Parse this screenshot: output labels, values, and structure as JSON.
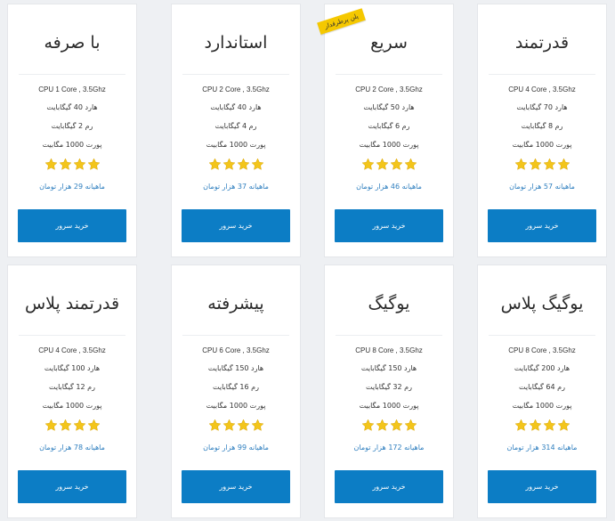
{
  "colors": {
    "accent": "#0c7dc5",
    "price": "#2f7fbf",
    "ribbon": "#f5c800",
    "star": "#f3c51b"
  },
  "icons": {
    "rating": "star-icon"
  },
  "plans": [
    {
      "name": "قدرتمند",
      "cpu": "CPU 4 Core , 3.5Ghz",
      "disk": "هارد 70 گیگابایت",
      "ram": "رم 8 گیگابایت",
      "port": "پورت 1000 مگابیت",
      "rating": 4,
      "price": "ماهیانه 57 هزار تومان",
      "button": "خرید سرور"
    },
    {
      "name": "سریع",
      "cpu": "CPU 2 Core , 3.5Ghz",
      "disk": "هارد 50 گیگابایت",
      "ram": "رم 6 گیگابایت",
      "port": "پورت 1000 مگابیت",
      "rating": 4,
      "price": "ماهیانه 46 هزار تومان",
      "button": "خرید سرور",
      "badge": "پلن پرطرفدار"
    },
    {
      "name": "استاندارد",
      "cpu": "CPU 2 Core , 3.5Ghz",
      "disk": "هارد 40 گیگابایت",
      "ram": "رم 4 گیگابایت",
      "port": "پورت 1000 مگابیت",
      "rating": 4,
      "price": "ماهیانه 37 هزار تومان",
      "button": "خرید سرور"
    },
    {
      "name": "با صرفه",
      "cpu": "CPU 1 Core , 3.5Ghz",
      "disk": "هارد 40 گیگابایت",
      "ram": "رم 2 گیگابایت",
      "port": "پورت 1000 مگابیت",
      "rating": 4,
      "price": "ماهیانه 29 هزار تومان",
      "button": "خرید سرور"
    },
    {
      "name": "یوگیگ پلاس",
      "cpu": "CPU 8 Core , 3.5Ghz",
      "disk": "هارد 200 گیگابایت",
      "ram": "رم 64 گیگابایت",
      "port": "پورت 1000 مگابیت",
      "rating": 4,
      "price": "ماهیانه 314 هزار تومان",
      "button": "خرید سرور"
    },
    {
      "name": "یوگیگ",
      "cpu": "CPU 8 Core , 3.5Ghz",
      "disk": "هارد 150 گیگابایت",
      "ram": "رم 32 گیگابایت",
      "port": "پورت 1000 مگابیت",
      "rating": 4,
      "price": "ماهیانه 172 هزار تومان",
      "button": "خرید سرور"
    },
    {
      "name": "پیشرفته",
      "cpu": "CPU 6 Core , 3.5Ghz",
      "disk": "هارد 150 گیگابایت",
      "ram": "رم 16 گیگابایت",
      "port": "پورت 1000 مگابیت",
      "rating": 4,
      "price": "ماهیانه 99 هزار تومان",
      "button": "خرید سرور"
    },
    {
      "name": "قدرتمند پلاس",
      "cpu": "CPU 4 Core , 3.5Ghz",
      "disk": "هارد 100 گیگابایت",
      "ram": "رم 12 گیگابایت",
      "port": "پورت 1000 مگابیت",
      "rating": 4,
      "price": "ماهیانه 78 هزار تومان",
      "button": "خرید سرور"
    }
  ]
}
